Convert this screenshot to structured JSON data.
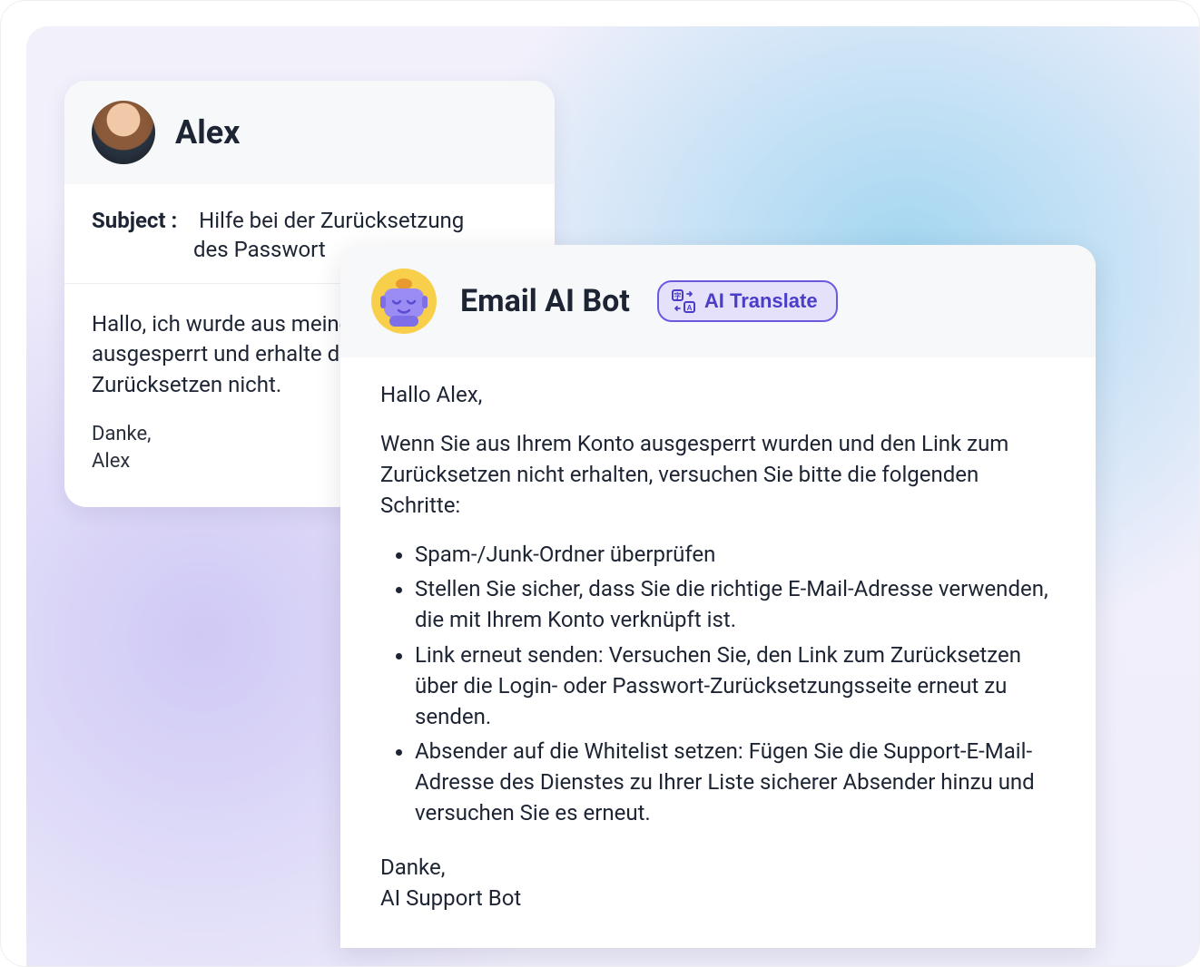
{
  "user_card": {
    "sender_name": "Alex",
    "subject_label": "Subject :",
    "subject_line1": "Hilfe bei der Zurücksetzung",
    "subject_line2": "des Passwort",
    "body": "Hallo, ich wurde aus meinem Konto ausgesperrt und erhalte den Link zum Zurücksetzen nicht.",
    "sign_thanks": "Danke,",
    "sign_name": "Alex"
  },
  "bot_card": {
    "bot_name": "Email AI Bot",
    "translate_label": "AI Translate",
    "greeting": "Hallo Alex,",
    "intro": "Wenn Sie aus Ihrem Konto ausgesperrt wurden und den Link zum Zurücksetzen nicht erhalten, versuchen Sie bitte die folgenden Schritte:",
    "steps": [
      "Spam-/Junk-Ordner überprüfen",
      "Stellen Sie sicher, dass Sie die richtige E-Mail-Adresse verwenden, die mit Ihrem Konto verknüpft ist.",
      "Link erneut senden: Versuchen Sie, den Link zum Zurücksetzen über die Login- oder Passwort-Zurücksetzungsseite erneut zu senden.",
      "Absender auf die Whitelist setzen: Fügen Sie die Support-E-Mail-Adresse des Dienstes zu Ihrer Liste sicherer Absender hinzu und versuchen Sie es erneut."
    ],
    "sign_thanks": "Danke,",
    "sign_name": "AI Support Bot"
  }
}
